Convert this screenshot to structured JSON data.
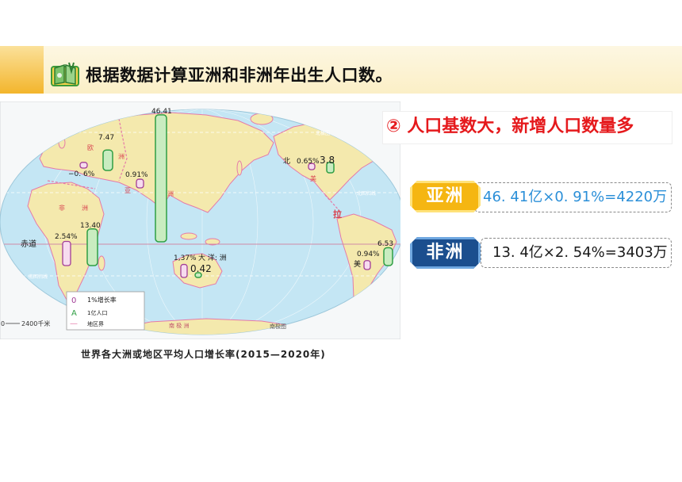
{
  "header": {
    "title": "根据数据计算亚洲和非洲年出生人口数。",
    "icon": "book-icon"
  },
  "map": {
    "markers": {
      "asia": {
        "population": 46.41,
        "population_label": "46.41",
        "growth": 0.91,
        "growth_label": "0.91%"
      },
      "europe": {
        "population": 7.47,
        "population_label": "7.47",
        "growth": -0.6,
        "growth_label": "−0. 6%"
      },
      "africa": {
        "population": 13.4,
        "population_label": "13.40",
        "growth": 2.54,
        "growth_label": "2.54%"
      },
      "north_america": {
        "population": 3.8,
        "population_label": "3.8",
        "growth": 0.65,
        "growth_label": "0.65%"
      },
      "latin_america": {
        "population": 6.53,
        "population_label": "6.53",
        "growth": 0.94,
        "growth_label": "0.94%"
      },
      "oceania": {
        "population": 0.42,
        "population_label": "0.42",
        "growth": 1.37,
        "growth_label": "1,37%"
      }
    },
    "place_labels": {
      "equator": "赤道",
      "asia_1": "亚",
      "asia_2": "洲",
      "africa_1": "非",
      "africa_2": "洲",
      "europe_1": "欧",
      "europe_2": "洲",
      "north_america_1": "北",
      "north_america_2": "美",
      "latin_america_1": "拉",
      "latin_america_2": "美",
      "oceania": "大   洋: 洲",
      "antarctica": "南 极 洲",
      "south_pole_map": "南极图",
      "tropic_cancer": "北回归线",
      "tropic_capricorn": "南回归线",
      "arctic_circle": "北极圈"
    },
    "legend": [
      {
        "symbol": "0",
        "label": "1%增长率"
      },
      {
        "symbol": "A",
        "label": "1亿人口"
      },
      {
        "symbol": "—",
        "label": "地区界"
      }
    ],
    "scale": {
      "zero": "0",
      "distance": "2400千米"
    },
    "colors": {
      "ocean": "#c4e6f4",
      "land": "#f4e9ad",
      "population_bar": "#2f9e44",
      "growth_bar": "#a23d96",
      "boundary": "#e57aa8"
    }
  },
  "caption": "世界各大洲或地区平均人口增长率(2015—2020年)",
  "point": "② 人口基数大，新增人口数量多",
  "calculations": [
    {
      "region": "亚洲",
      "formula": "46. 41亿×0. 91%=4220万",
      "badge_color": "#f5b612",
      "text_color": "#2b8fd8"
    },
    {
      "region": "非洲",
      "formula": "13. 4亿×2. 54%=3403万",
      "badge_color": "#1b4e8e",
      "text_color": "#1a1a1a"
    }
  ]
}
